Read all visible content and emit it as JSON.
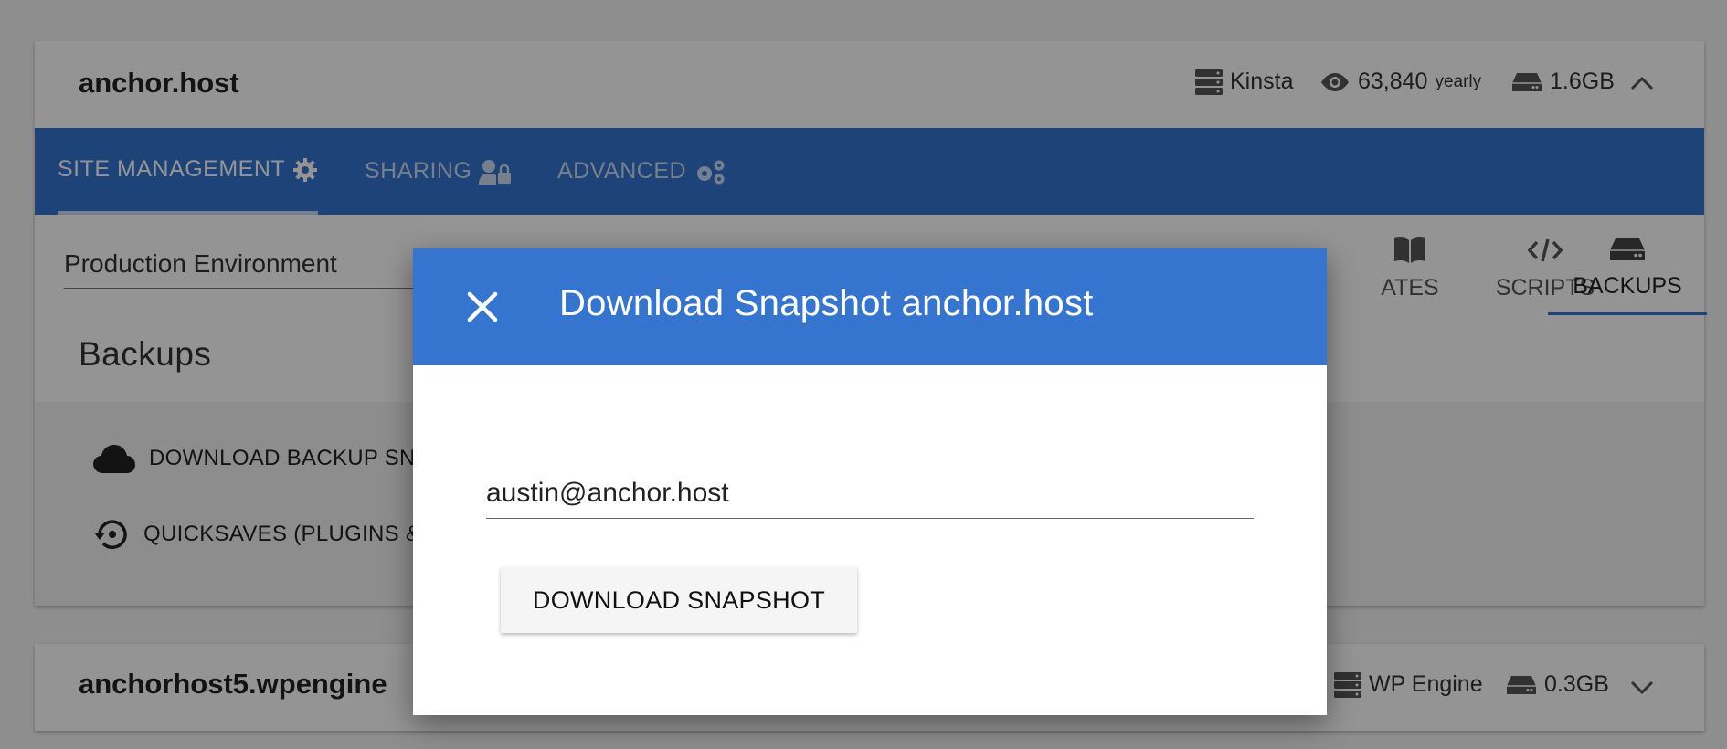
{
  "site1": {
    "name": "anchor.host",
    "provider": "Kinsta",
    "views": "63,840",
    "views_period": "yearly",
    "storage": "1.6GB"
  },
  "tabs": [
    {
      "label": "SITE MANAGEMENT",
      "icon": "gear-icon"
    },
    {
      "label": "SHARING",
      "icon": "user-lock-icon"
    },
    {
      "label": "ADVANCED",
      "icon": "cogs-icon"
    }
  ],
  "environment": "Production Environment",
  "subtabs": [
    {
      "label": "ATES",
      "icon": "book-icon"
    },
    {
      "label": "SCRIPTS",
      "icon": "code-icon"
    },
    {
      "label": "BACKUPS",
      "icon": "hdd-icon"
    }
  ],
  "section_title": "Backups",
  "actions": [
    {
      "label": "DOWNLOAD BACKUP SN",
      "icon": "cloud-icon"
    },
    {
      "label": "QUICKSAVES (PLUGINS &",
      "icon": "history-icon"
    }
  ],
  "site2": {
    "name": "anchorhost5.wpengine",
    "provider": "WP Engine",
    "storage": "0.3GB"
  },
  "dialog": {
    "title": "Download Snapshot anchor.host",
    "email_value": "austin@anchor.host",
    "button_label": "DOWNLOAD SNAPSHOT"
  },
  "colors": {
    "primary": "#3575d0",
    "overlay": "rgba(0,0,0,0.42)"
  }
}
